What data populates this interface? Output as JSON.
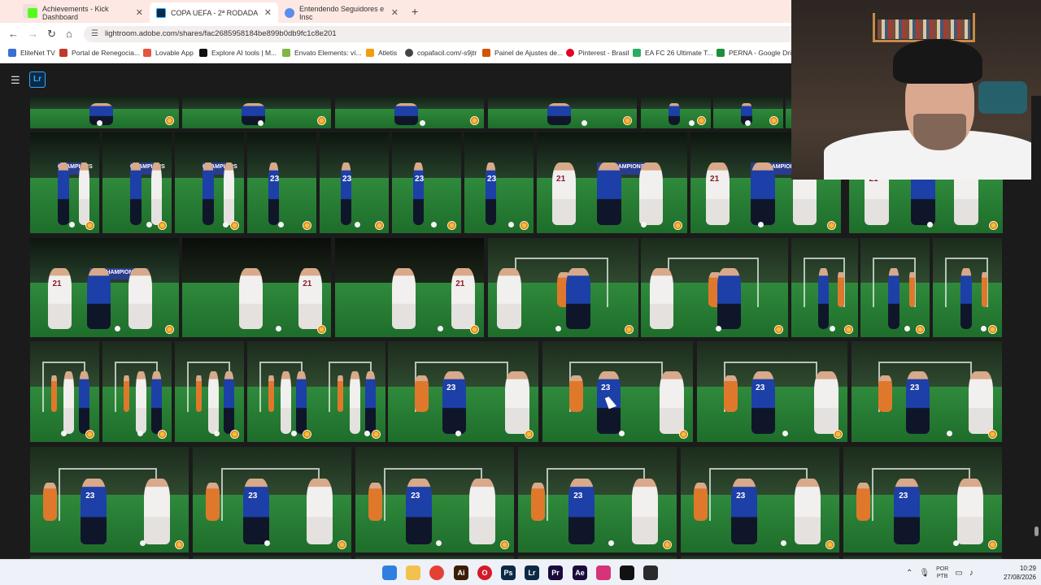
{
  "browser": {
    "tabs": [
      {
        "title": "Achievements - Kick Dashboard",
        "active": false,
        "icon": "kick-icon",
        "color": "#53fc18"
      },
      {
        "title": "COPA UEFA - 2ª RODADA",
        "active": true,
        "icon": "lightroom-icon",
        "color": "#0c2a45"
      },
      {
        "title": "Entendendo Seguidores e Insc",
        "active": false,
        "icon": "gemini-icon",
        "color": "#5b8def"
      }
    ],
    "url": "lightroom.adobe.com/shares/fac2685958184be899b0db9fc1c8e201",
    "bookmarks": [
      {
        "label": "EliteNet TV",
        "color": "#3b6fd8"
      },
      {
        "label": "Portal de Renegocia...",
        "color": "#c0392b"
      },
      {
        "label": "Lovable App",
        "color": "#e7543e"
      },
      {
        "label": "Explore AI tools | M...",
        "color": "#111111"
      },
      {
        "label": "Envato Elements: ví...",
        "color": "#82b541"
      },
      {
        "label": "Atletis",
        "color": "#f39c12"
      },
      {
        "label": "copafacil.com/-s9jtr",
        "color": "#444444"
      },
      {
        "label": "Painel de Ajustes de...",
        "color": "#d35400"
      },
      {
        "label": "Pinterest - Brasil",
        "color": "#e60023"
      },
      {
        "label": "EA FC 26 Ultimate T...",
        "color": "#27ae60"
      },
      {
        "label": "PERNA - Google Dri...",
        "color": "#1e8e3e"
      }
    ]
  },
  "app": {
    "logo": "Lr"
  },
  "banner_text": "CHAMPIONS",
  "jersey_numbers": {
    "white": "21",
    "blue": "23"
  },
  "taskbar": {
    "apps": [
      {
        "name": "windows-start-icon",
        "label": "",
        "color": "#2f7fe0"
      },
      {
        "name": "file-explorer-icon",
        "label": "",
        "color": "#f2c14e"
      },
      {
        "name": "chrome-icon",
        "label": "",
        "color": "#e34133"
      },
      {
        "name": "illustrator-icon",
        "label": "Ai",
        "color": "#3b1e07"
      },
      {
        "name": "opera-icon",
        "label": "O",
        "color": "#d21b2a"
      },
      {
        "name": "photoshop-icon",
        "label": "Ps",
        "color": "#0c2a45"
      },
      {
        "name": "lightroom-taskbar-icon",
        "label": "Lr",
        "color": "#0c2a45"
      },
      {
        "name": "premiere-icon",
        "label": "Pr",
        "color": "#1a0b3c"
      },
      {
        "name": "after-effects-icon",
        "label": "Ae",
        "color": "#1a0b3c"
      },
      {
        "name": "instagram-icon",
        "label": "",
        "color": "#d6337a"
      },
      {
        "name": "capcut-icon",
        "label": "",
        "color": "#111111"
      },
      {
        "name": "obs-icon",
        "label": "",
        "color": "#2b2b2b"
      }
    ],
    "tray": {
      "lang_top": "POR",
      "lang_bottom": "PTB",
      "time": "10:29",
      "date": "27/08/2026"
    }
  }
}
